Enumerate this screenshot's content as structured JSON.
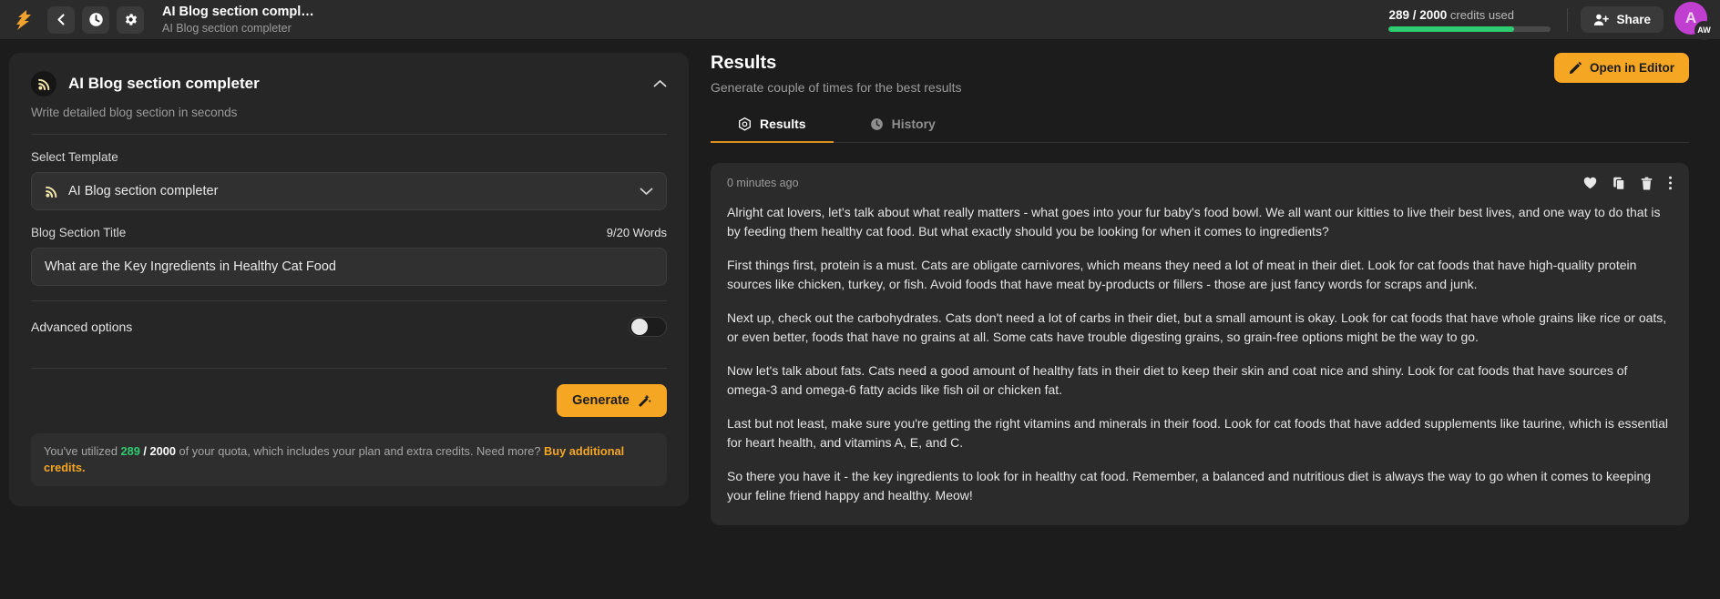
{
  "topbar": {
    "logo_icon": "lightning-s-logo",
    "back_icon": "chevron-left-icon",
    "history_icon": "clock-icon",
    "settings_icon": "gear-icon",
    "title": "AI Blog section compl…",
    "subtitle": "AI Blog section completer",
    "credits": {
      "used": "289",
      "separator": " / ",
      "total": "2000",
      "suffix": " credits used",
      "percent": 77
    },
    "share_label": "Share",
    "share_icon": "person-add-icon",
    "avatar_initial": "A",
    "avatar_badge": "AW",
    "avatar_color": "#c13fd0"
  },
  "left_panel": {
    "card_title": "AI Blog section completer",
    "card_icon": "rss-signal-icon",
    "collapse_icon": "chevron-up-icon",
    "card_subtitle": "Write detailed blog section in seconds",
    "select_template_label": "Select Template",
    "selected_template": "AI Blog section completer",
    "select_chevron_icon": "chevron-down-icon",
    "blog_title_label": "Blog Section Title",
    "word_count": "9/20 Words",
    "blog_title_value": "What are the Key Ingredients in Healthy Cat Food",
    "blog_title_placeholder": "Enter blog section title",
    "advanced_options_label": "Advanced options",
    "advanced_options_state": "off",
    "generate_label": "Generate",
    "generate_icon": "magic-wand-icon",
    "quota": {
      "prefix": "You've utilized ",
      "used": "289",
      "slash": " / ",
      "total": "2000",
      "middle": " of your quota, which includes your plan and extra credits. Need more? ",
      "link": "Buy additional credits."
    }
  },
  "right_panel": {
    "title": "Results",
    "subtitle": "Generate couple of times for the best results",
    "open_editor_label": "Open in Editor",
    "open_editor_icon": "pencil-icon",
    "tabs": [
      {
        "label": "Results",
        "icon": "gear-hex-icon",
        "active": true
      },
      {
        "label": "History",
        "icon": "clock-icon",
        "active": false
      }
    ],
    "result": {
      "timestamp": "0 minutes ago",
      "icons": [
        "heart-icon",
        "copy-icon",
        "trash-icon",
        "more-vertical-icon"
      ],
      "paragraphs": [
        "Alright cat lovers, let's talk about what really matters - what goes into your fur baby's food bowl. We all want our kitties to live their best lives, and one way to do that is by feeding them healthy cat food. But what exactly should you be looking for when it comes to ingredients?",
        "First things first, protein is a must. Cats are obligate carnivores, which means they need a lot of meat in their diet. Look for cat foods that have high-quality protein sources like chicken, turkey, or fish. Avoid foods that have meat by-products or fillers - those are just fancy words for scraps and junk.",
        "Next up, check out the carbohydrates. Cats don't need a lot of carbs in their diet, but a small amount is okay. Look for cat foods that have whole grains like rice or oats, or even better, foods that have no grains at all. Some cats have trouble digesting grains, so grain-free options might be the way to go.",
        "Now let's talk about fats. Cats need a good amount of healthy fats in their diet to keep their skin and coat nice and shiny. Look for cat foods that have sources of omega-3 and omega-6 fatty acids like fish oil or chicken fat.",
        "Last but not least, make sure you're getting the right vitamins and minerals in their food. Look for cat foods that have added supplements like taurine, which is essential for heart health, and vitamins A, E, and C.",
        "So there you have it - the key ingredients to look for in healthy cat food. Remember, a balanced and nutritious diet is always the way to go when it comes to keeping your feline friend happy and healthy. Meow!"
      ]
    }
  },
  "colors": {
    "accent_orange": "#f5a623",
    "success_green": "#2ecc71",
    "bg": "#1c1c1c",
    "panel": "#262626"
  }
}
